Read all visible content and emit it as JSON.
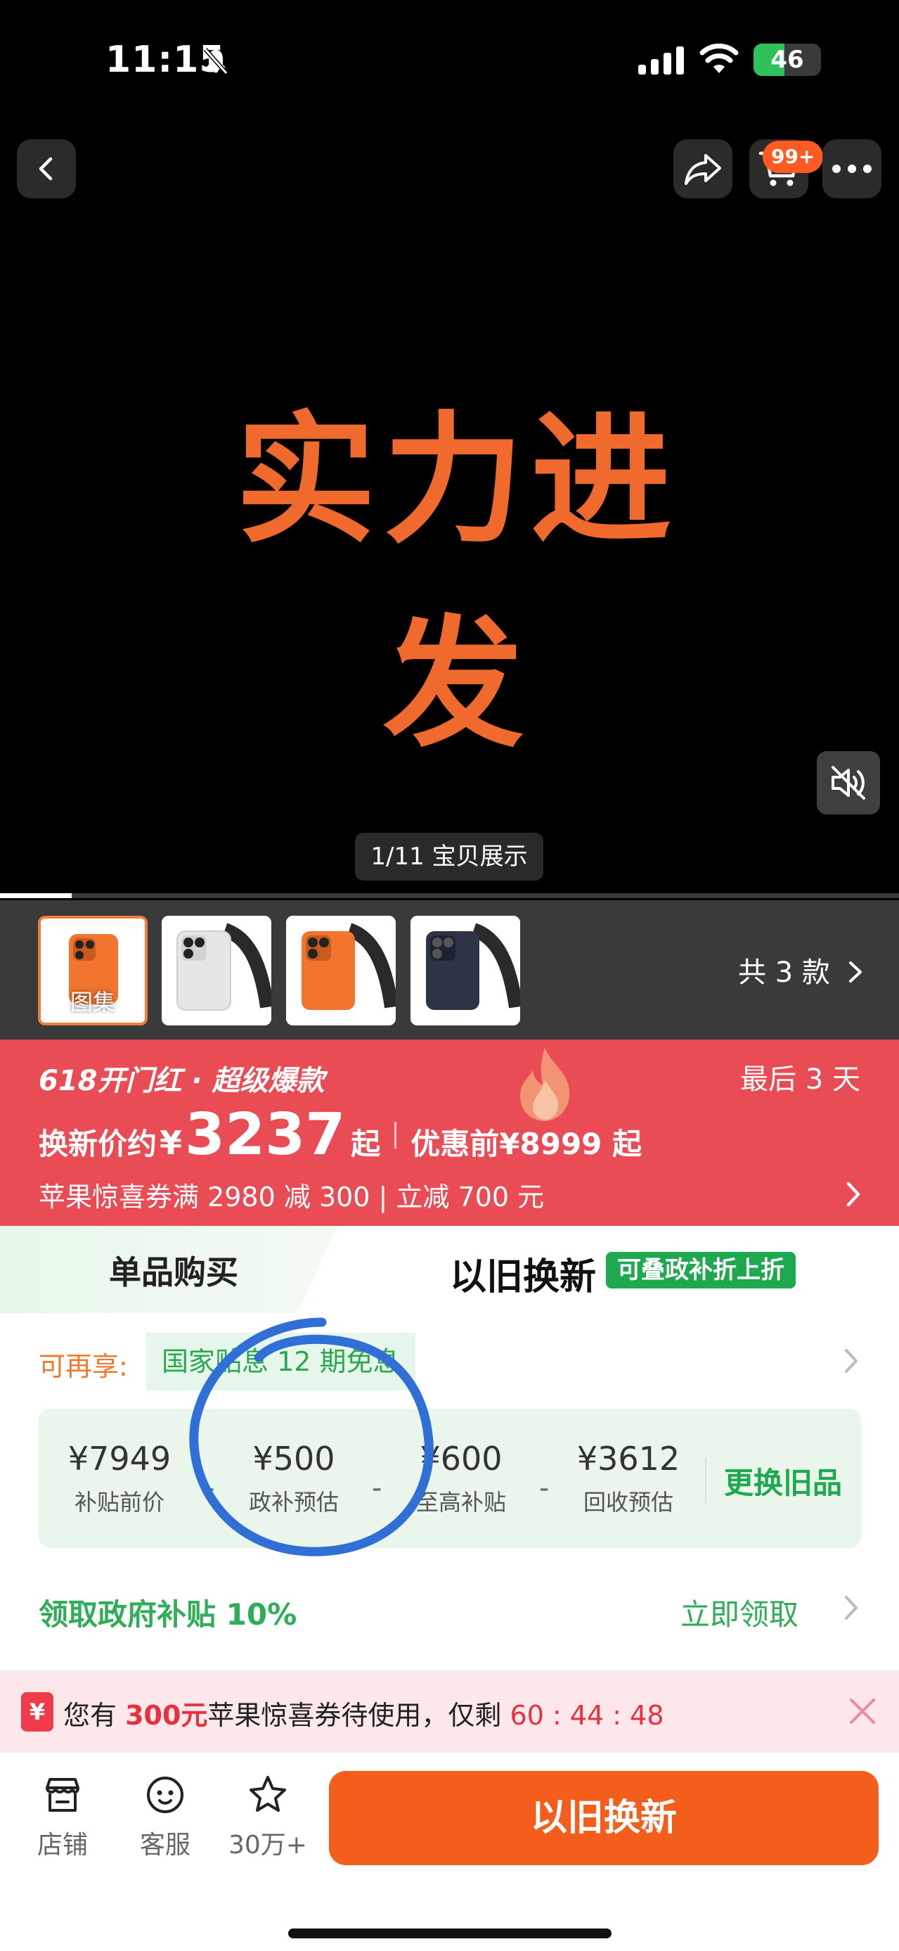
{
  "status_bar": {
    "time": "11:15",
    "battery": "46",
    "battery_level_percent": 46
  },
  "header": {
    "cart_badge": "99+"
  },
  "hero": {
    "title": "实力进发",
    "pager": "1/11 宝贝展示",
    "video_progress_fraction": 0.08
  },
  "thumbnails": {
    "items": [
      {
        "label": "图集",
        "color": "#f2752f"
      },
      {
        "label": "",
        "color": "#e6e6e6"
      },
      {
        "label": "",
        "color": "#f2752f"
      },
      {
        "label": "",
        "color": "#2c3446"
      }
    ],
    "variants": "共 3 款"
  },
  "promo": {
    "event": "618开门红 · 超级爆款",
    "countdown": "最后 3 天",
    "price_label": "换新价约",
    "currency": "¥",
    "price": "3237",
    "price_suffix": "起",
    "original_price": "优惠前¥8999 起",
    "coupon_line": "苹果惊喜券满 2980 减 300 | 立减 700 元"
  },
  "tabs": {
    "single": "单品购买",
    "trade_in": "以旧换新",
    "trade_in_badge": "可叠政补折上折"
  },
  "reenjoy": {
    "label": "可再享:",
    "tag": "国家贴息 12 期免息"
  },
  "subsidy": {
    "items": [
      {
        "value": "¥7949",
        "label": "补贴前价"
      },
      {
        "value": "¥500",
        "label": "政补预估"
      },
      {
        "value": "¥600",
        "label": "至高补贴"
      },
      {
        "value": "¥3612",
        "label": "回收预估"
      }
    ],
    "minus": "-",
    "replace_button": "更换旧品"
  },
  "gov_subsidy": {
    "label": "领取政府补贴 10%",
    "action": "立即领取"
  },
  "coupon_banner": {
    "prefix": "您有 ",
    "amount": "300元",
    "middle": "苹果惊喜券待使用，仅剩 ",
    "time_left": "60 : 44 : 48",
    "icon": "¥"
  },
  "bottom_nav": {
    "store": "店铺",
    "service": "客服",
    "favorites": "30万+",
    "cta": "以旧换新"
  },
  "colors": {
    "brand_orange": "#f45e1c",
    "promo_red": "#e94c55",
    "green": "#1ea84f",
    "annotation_blue": "#2f6fd6"
  }
}
